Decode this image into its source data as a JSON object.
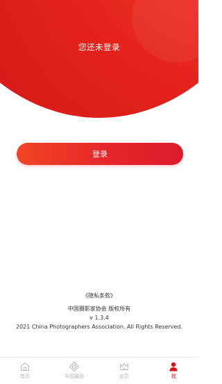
{
  "header": {
    "title": "您还未登录"
  },
  "login_button": {
    "label": "登录"
  },
  "footer": {
    "privacy_link": "《隐私条款》",
    "org_copyright": "中国摄影家协会 版权所有",
    "version": "v 1.3.4",
    "copyright_en": "2021 China Photographers Association. All Rights Reserved."
  },
  "tabbar": {
    "items": [
      {
        "label": "首页",
        "icon": "home-icon",
        "active": false
      },
      {
        "label": "中国摄协",
        "icon": "diamond-icon",
        "active": false
      },
      {
        "label": "会员",
        "icon": "crown-icon",
        "active": false
      },
      {
        "label": "我",
        "icon": "user-icon",
        "active": true
      }
    ]
  },
  "colors": {
    "brand_red": "#e3221b",
    "inactive_tab": "#b5b5b5",
    "active_tab": "#d8131d"
  }
}
